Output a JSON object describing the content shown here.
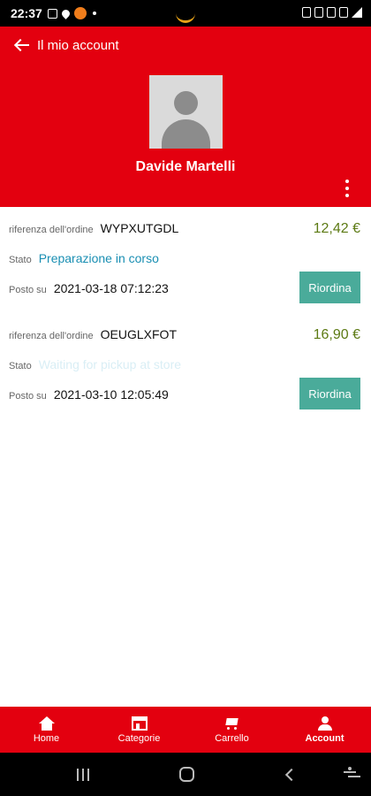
{
  "status_bar": {
    "time": "22:37"
  },
  "header": {
    "back_label": "Il mio account",
    "profile_name": "Davide Martelli"
  },
  "orders": [
    {
      "ref_label": "riferenza dell'ordine",
      "ref": "WYPXUTGDL",
      "price": "12,42 €",
      "status_label": "Stato",
      "status": "Preparazione in corso",
      "posted_label": "Posto su",
      "posted": "2021-03-18 07:12:23",
      "reorder_label": "Riordina"
    },
    {
      "ref_label": "riferenza dell'ordine",
      "ref": "OEUGLXFOT",
      "price": "16,90 €",
      "status_label": "Stato",
      "status": "Waiting for pickup at store",
      "posted_label": "Posto su",
      "posted": "2021-03-10 12:05:49",
      "reorder_label": "Riordina"
    }
  ],
  "bottom_nav": {
    "items": [
      {
        "label": "Home",
        "icon": "home-icon"
      },
      {
        "label": "Categorie",
        "icon": "store-icon"
      },
      {
        "label": "Carrello",
        "icon": "cart-icon"
      },
      {
        "label": "Account",
        "icon": "user-icon",
        "active": true
      }
    ]
  },
  "colors": {
    "brand_red": "#e3000f",
    "reorder_teal": "#4aab9a",
    "price_green": "#5c7a13",
    "status_blue": "#1a8fb3"
  }
}
